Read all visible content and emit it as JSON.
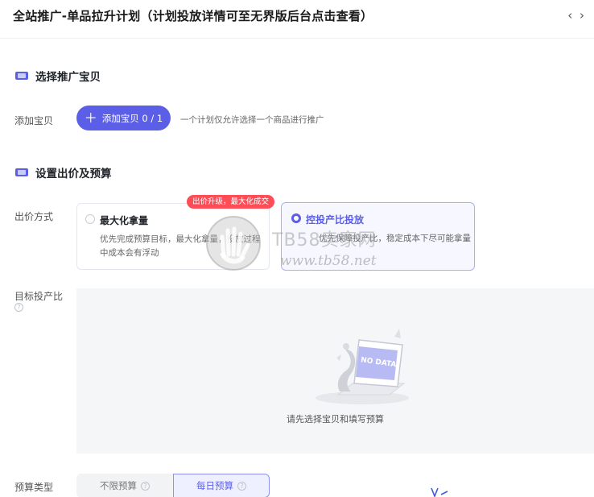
{
  "header": {
    "title": "全站推广-单品拉升计划（计划投放详情可至无界版后台点击查看）",
    "nav_symbol": "‹ ›"
  },
  "section_product": {
    "title": "选择推广宝贝",
    "icon": "ticket-icon",
    "add_label": "添加宝贝",
    "add_button": "添加宝贝 0 / 1",
    "add_hint": "一个计划仅允许选择一个商品进行推广"
  },
  "section_bid": {
    "title": "设置出价及预算",
    "icon": "ticket-icon",
    "bid_label": "出价方式",
    "tag": "出价升级，最大化成交",
    "options": [
      {
        "title": "最大化拿量",
        "desc": "优先完成预算目标，最大化拿量，投放过程中成本会有浮动",
        "selected": false
      },
      {
        "title": "控投产比投放",
        "desc": "优先保障投产比，稳定成本下尽可能拿量",
        "selected": true
      }
    ],
    "target_roi_label": "目标投产比",
    "empty_text": "请先选择宝贝和填写预算",
    "empty_image_text": "NO DATA"
  },
  "budget": {
    "label": "预算类型",
    "options": [
      {
        "label": "不限预算",
        "selected": false
      },
      {
        "label": "每日预算",
        "selected": true
      }
    ]
  },
  "watermark": {
    "line1": "TB58卖家网",
    "line2": "www.tb58.net"
  },
  "colors": {
    "primary": "#5b5fe8",
    "tag_red": "#ff4d57",
    "empty_bg": "#f5f6f8"
  }
}
